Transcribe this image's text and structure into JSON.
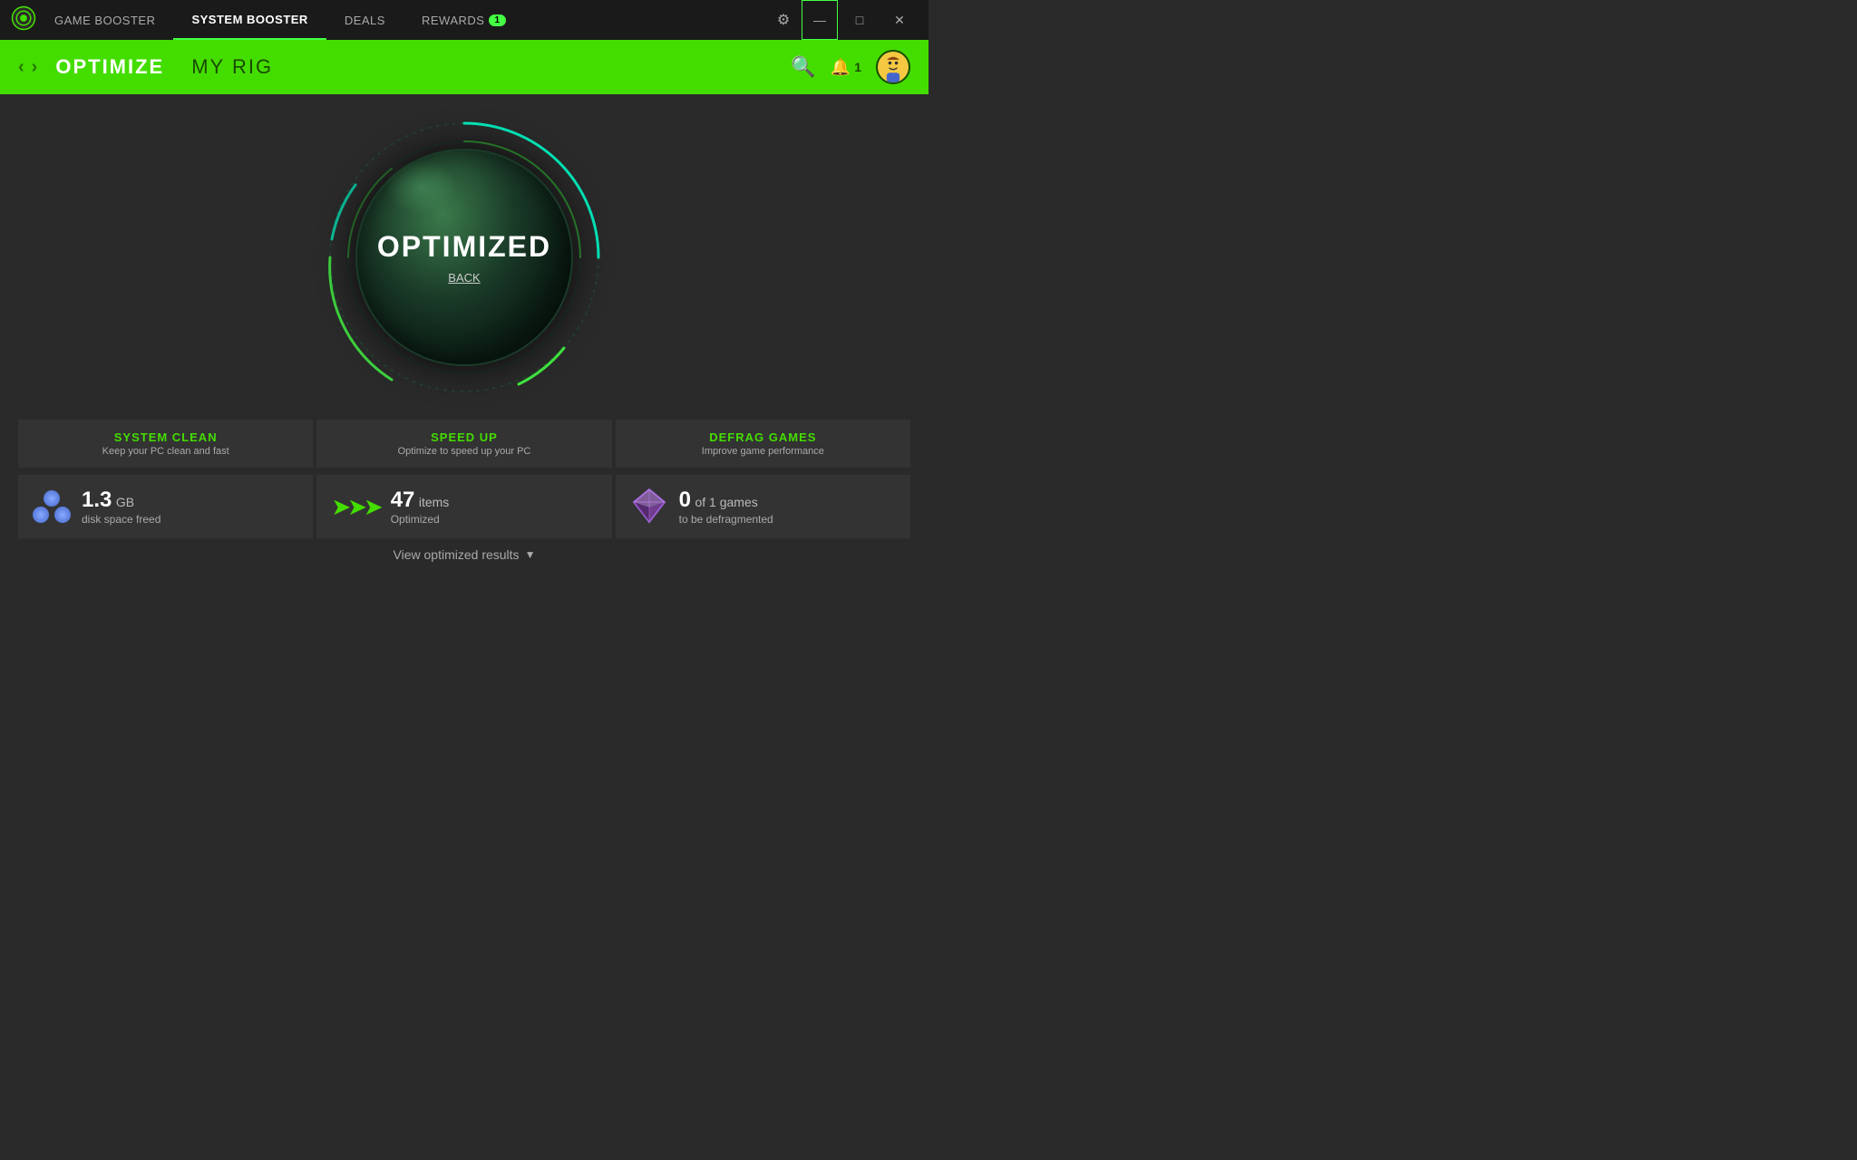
{
  "titleBar": {
    "tabs": [
      {
        "id": "game-booster",
        "label": "GAME BOOSTER",
        "active": false
      },
      {
        "id": "system-booster",
        "label": "SYSTEM BOOSTER",
        "active": true
      },
      {
        "id": "deals",
        "label": "DEALS",
        "active": false
      },
      {
        "id": "rewards",
        "label": "REWARDS",
        "active": false,
        "badge": "1"
      }
    ],
    "settingsTitle": "settings",
    "minimizeTitle": "minimize",
    "maximizeTitle": "maximize",
    "closeTitle": "close"
  },
  "subHeader": {
    "backArrow": "‹",
    "forwardArrow": "›",
    "navItems": [
      {
        "id": "optimize",
        "label": "OPTIMIZE",
        "active": true
      },
      {
        "id": "my-rig",
        "label": "MY RIG",
        "active": false
      }
    ],
    "notificationCount": "1"
  },
  "main": {
    "circleLabel": "OPTIMIZED",
    "backLink": "BACK"
  },
  "stats": {
    "cards": [
      {
        "id": "system-clean",
        "title": "SYSTEM CLEAN",
        "subtitle": "Keep your PC clean and fast",
        "value": "1.3",
        "unit": "GB",
        "detail": "disk space freed"
      },
      {
        "id": "speed-up",
        "title": "SPEED UP",
        "subtitle": "Optimize to speed up your PC",
        "value": "47",
        "unit": "items",
        "detail": "Optimized"
      },
      {
        "id": "defrag-games",
        "title": "DEFRAG GAMES",
        "subtitle": "Improve game performance",
        "value": "0",
        "unit": "of 1 games",
        "detail": "to be defragmented"
      }
    ],
    "viewResults": "View optimized results"
  }
}
